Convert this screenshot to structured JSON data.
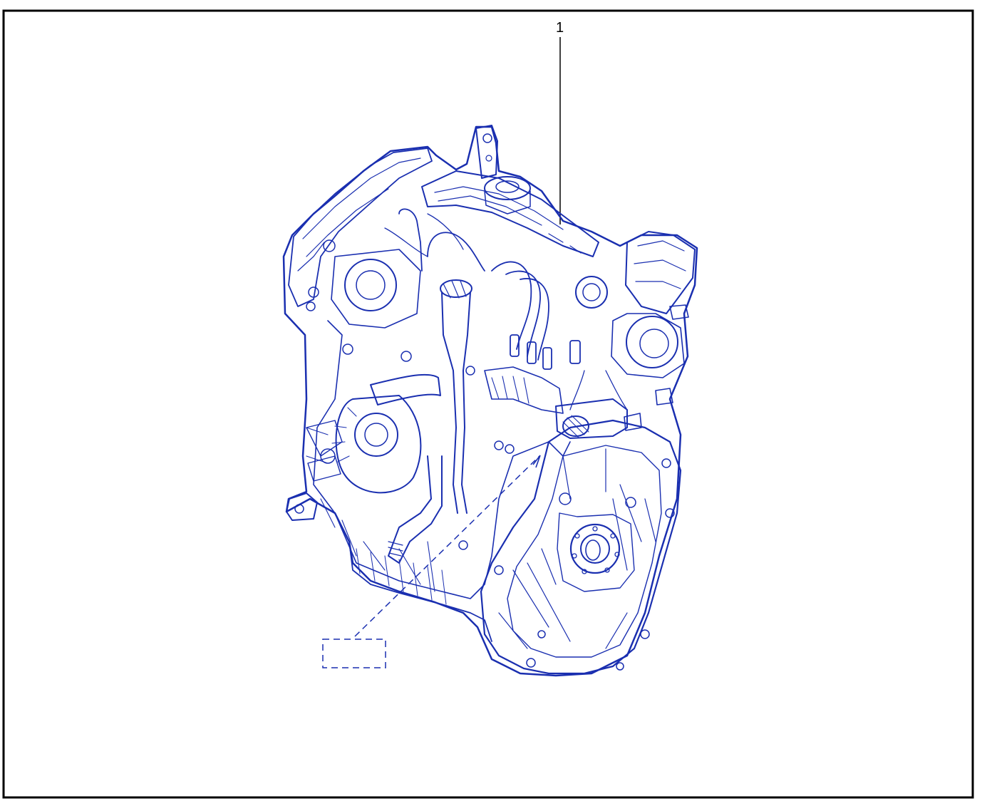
{
  "diagram": {
    "callouts": [
      {
        "label": "1"
      }
    ],
    "colors": {
      "line_art": "#1a2fb0",
      "frame": "#000000",
      "background": "#ffffff",
      "callout_text": "#000000"
    },
    "icons": [
      "engine-assembly-illustration",
      "identification-plate-placeholder"
    ]
  }
}
